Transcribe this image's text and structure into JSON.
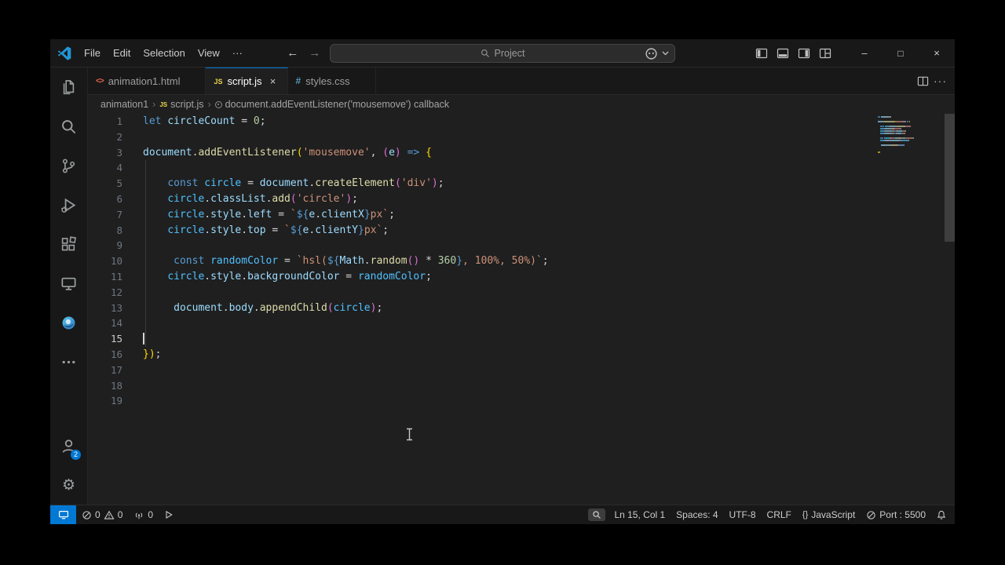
{
  "colors": {
    "accent": "#0078d4",
    "editor_bg": "#1f1f1f",
    "chrome_bg": "#181818"
  },
  "titlebar": {
    "menus": [
      "File",
      "Edit",
      "Selection",
      "View",
      "···"
    ],
    "search": {
      "placeholder": "Project"
    }
  },
  "glyphs": {
    "minimize": "–",
    "maximize": "□",
    "close": "×",
    "back": "←",
    "forward": "→",
    "tab_close": "×",
    "more_dots": "···",
    "braces": "{}"
  },
  "file_icons": {
    "html": "<>",
    "js": "JS",
    "css": "#"
  },
  "tabbar": {
    "tabs": [
      {
        "label": "animation1.html",
        "icon": "html",
        "active": false
      },
      {
        "label": "script.js",
        "icon": "js",
        "active": true
      },
      {
        "label": "styles.css",
        "icon": "css",
        "active": false
      }
    ]
  },
  "breadcrumb": {
    "items": [
      {
        "label": "animation1"
      },
      {
        "label": "script.js",
        "icon": "js"
      },
      {
        "label": "document.addEventListener('mousemove') callback",
        "icon": "symbol"
      }
    ]
  },
  "editor": {
    "cursor_line": 15,
    "total_lines": 19,
    "lines": [
      {
        "t": [
          [
            "kw",
            "let"
          ],
          [
            "pl",
            " "
          ],
          [
            "v",
            "circleCount"
          ],
          [
            "pl",
            " = "
          ],
          [
            "n",
            "0"
          ],
          [
            "pl",
            ";"
          ]
        ]
      },
      {
        "t": []
      },
      {
        "t": [
          [
            "v",
            "document"
          ],
          [
            "pl",
            "."
          ],
          [
            "fn",
            "addEventListener"
          ],
          [
            "b1",
            "("
          ],
          [
            "s",
            "'mousemove'"
          ],
          [
            "pl",
            ", "
          ],
          [
            "b2",
            "("
          ],
          [
            "v",
            "e"
          ],
          [
            "b2",
            ")"
          ],
          [
            "pl",
            " "
          ],
          [
            "kw",
            "=>"
          ],
          [
            "pl",
            " "
          ],
          [
            "b1",
            "{"
          ]
        ]
      },
      {
        "t": [],
        "g": 1
      },
      {
        "t": [
          [
            "pl",
            "    "
          ],
          [
            "kw",
            "const"
          ],
          [
            "pl",
            " "
          ],
          [
            "cv",
            "circle"
          ],
          [
            "pl",
            " = "
          ],
          [
            "v",
            "document"
          ],
          [
            "pl",
            "."
          ],
          [
            "fn",
            "createElement"
          ],
          [
            "b2",
            "("
          ],
          [
            "s",
            "'div'"
          ],
          [
            "b2",
            ")"
          ],
          [
            "pl",
            ";"
          ]
        ],
        "g": 1
      },
      {
        "t": [
          [
            "pl",
            "    "
          ],
          [
            "cv",
            "circle"
          ],
          [
            "pl",
            "."
          ],
          [
            "v",
            "classList"
          ],
          [
            "pl",
            "."
          ],
          [
            "fn",
            "add"
          ],
          [
            "b2",
            "("
          ],
          [
            "s",
            "'circle'"
          ],
          [
            "b2",
            ")"
          ],
          [
            "pl",
            ";"
          ]
        ],
        "g": 1
      },
      {
        "t": [
          [
            "pl",
            "    "
          ],
          [
            "cv",
            "circle"
          ],
          [
            "pl",
            "."
          ],
          [
            "v",
            "style"
          ],
          [
            "pl",
            "."
          ],
          [
            "v",
            "left"
          ],
          [
            "pl",
            " = "
          ],
          [
            "s",
            "`"
          ],
          [
            "tp",
            "${"
          ],
          [
            "v",
            "e"
          ],
          [
            "pl",
            "."
          ],
          [
            "v",
            "clientX"
          ],
          [
            "tp",
            "}"
          ],
          [
            "s",
            "px`"
          ],
          [
            "pl",
            ";"
          ]
        ],
        "g": 1
      },
      {
        "t": [
          [
            "pl",
            "    "
          ],
          [
            "cv",
            "circle"
          ],
          [
            "pl",
            "."
          ],
          [
            "v",
            "style"
          ],
          [
            "pl",
            "."
          ],
          [
            "v",
            "top"
          ],
          [
            "pl",
            " = "
          ],
          [
            "s",
            "`"
          ],
          [
            "tp",
            "${"
          ],
          [
            "v",
            "e"
          ],
          [
            "pl",
            "."
          ],
          [
            "v",
            "clientY"
          ],
          [
            "tp",
            "}"
          ],
          [
            "s",
            "px`"
          ],
          [
            "pl",
            ";"
          ]
        ],
        "g": 1
      },
      {
        "t": [],
        "g": 1
      },
      {
        "t": [
          [
            "pl",
            "     "
          ],
          [
            "kw",
            "const"
          ],
          [
            "pl",
            " "
          ],
          [
            "cv",
            "randomColor"
          ],
          [
            "pl",
            " = "
          ],
          [
            "s",
            "`hsl("
          ],
          [
            "tp",
            "${"
          ],
          [
            "v",
            "Math"
          ],
          [
            "pl",
            "."
          ],
          [
            "fn",
            "random"
          ],
          [
            "b2",
            "()"
          ],
          [
            "pl",
            " * "
          ],
          [
            "n",
            "360"
          ],
          [
            "tp",
            "}"
          ],
          [
            "s",
            ", 100%, 50%)`"
          ],
          [
            "pl",
            ";"
          ]
        ],
        "g": 1
      },
      {
        "t": [
          [
            "pl",
            "    "
          ],
          [
            "cv",
            "circle"
          ],
          [
            "pl",
            "."
          ],
          [
            "v",
            "style"
          ],
          [
            "pl",
            "."
          ],
          [
            "v",
            "backgroundColor"
          ],
          [
            "pl",
            " = "
          ],
          [
            "cv",
            "randomColor"
          ],
          [
            "pl",
            ";"
          ]
        ],
        "g": 1
      },
      {
        "t": [],
        "g": 1
      },
      {
        "t": [
          [
            "pl",
            "     "
          ],
          [
            "v",
            "document"
          ],
          [
            "pl",
            "."
          ],
          [
            "v",
            "body"
          ],
          [
            "pl",
            "."
          ],
          [
            "fn",
            "appendChild"
          ],
          [
            "b2",
            "("
          ],
          [
            "cv",
            "circle"
          ],
          [
            "b2",
            ")"
          ],
          [
            "pl",
            ";"
          ]
        ],
        "g": 1
      },
      {
        "t": [],
        "g": 1
      },
      {
        "t": [],
        "g": 1
      },
      {
        "t": [
          [
            "b1",
            "}"
          ],
          [
            "b1",
            ")"
          ],
          [
            "pl",
            ";"
          ]
        ]
      },
      {
        "t": []
      },
      {
        "t": []
      },
      {
        "t": []
      }
    ]
  },
  "activity": {
    "account_badge": "2"
  },
  "status": {
    "errors": "0",
    "warnings": "0",
    "ports": "0",
    "ln_col": "Ln 15, Col 1",
    "indent": "Spaces: 4",
    "encoding": "UTF-8",
    "eol": "CRLF",
    "language": "JavaScript",
    "port": "Port : 5500"
  }
}
